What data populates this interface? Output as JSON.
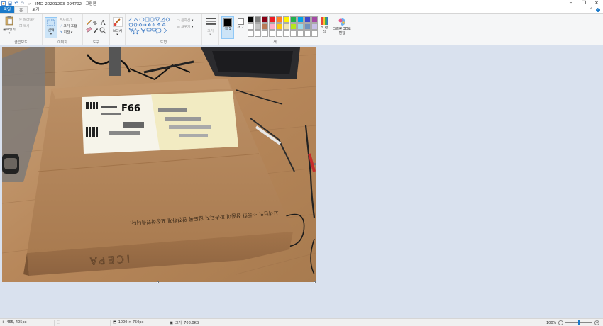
{
  "window": {
    "title": "IMG_20201203_094702 - 그림판",
    "controls": {
      "minimize": "─",
      "maximize": "❐",
      "close": "✕"
    }
  },
  "tabs": {
    "file": "파일",
    "home": "홈",
    "view": "보기"
  },
  "ribbon": {
    "clipboard": {
      "paste": "붙여넣기",
      "cut": "잘라내기",
      "copy": "복사",
      "label": "클립보드"
    },
    "image": {
      "select": "선택",
      "crop": "자르기",
      "resize": "크기 조정",
      "rotate": "회전",
      "label": "이미지"
    },
    "tools": {
      "label": "도구"
    },
    "brushes": {
      "label": "브러시"
    },
    "shapes": {
      "outline": "윤곽선",
      "fill": "채우기",
      "label": "도형"
    },
    "size": {
      "label": "크기"
    },
    "colors": {
      "color1": "색 1",
      "color2": "색 2",
      "edit_colors": "색 편집",
      "label": "색",
      "palette_row1": [
        "#000000",
        "#7f7f7f",
        "#880015",
        "#ed1c24",
        "#ff7f27",
        "#fff200",
        "#22b14c",
        "#00a2e8",
        "#3f48cc",
        "#a349a4"
      ],
      "palette_row2": [
        "#ffffff",
        "#c3c3c3",
        "#b97a57",
        "#ffaec9",
        "#ffc90e",
        "#efe4b0",
        "#b5e61d",
        "#99d9ea",
        "#7092be",
        "#c8bfe7"
      ]
    },
    "paint3d": {
      "label": "그림판 3D로 편집"
    }
  },
  "statusbar": {
    "cursor": "465, 405px",
    "dimensions": "1000 × 750px",
    "filesize": "크기: 708.0KB",
    "zoom": "100%"
  },
  "photo_text": {
    "box_text": "고객님의 소중한 상품이 파손되지 않도록 안전하게 포장하였습니다.",
    "brand": "ICEPA",
    "label_code": "F66"
  }
}
